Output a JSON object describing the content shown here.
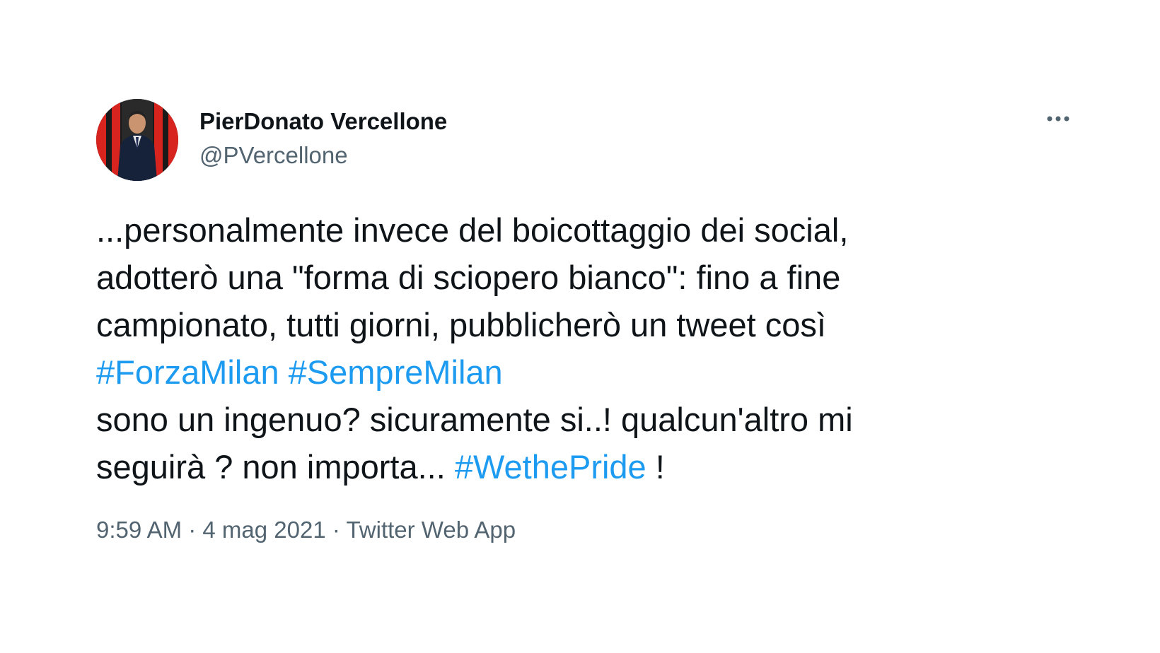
{
  "author": {
    "display_name": "PierDonato Vercellone",
    "handle": "@PVercellone",
    "avatar_icon": "profile-photo"
  },
  "menu": {
    "icon": "more-options-icon"
  },
  "tweet": {
    "line1": "...personalmente invece del boicottaggio dei social,",
    "line2": "adotterò una \"forma di sciopero bianco\": fino a fine",
    "line3": "campionato, tutti giorni, pubblicherò un tweet così",
    "hashtag1": "#ForzaMilan",
    "hashtag2": "#SempreMilan",
    "line5": "sono un ingenuo? sicuramente si..! qualcun'altro mi",
    "line6_start": "seguirà ? non importa... ",
    "hashtag3": "#WethePride",
    "line6_end": " !"
  },
  "meta": {
    "time": "9:59 AM",
    "separator": " · ",
    "date": "4 mag 2021",
    "source": "Twitter Web App"
  },
  "colors": {
    "text": "#0f1419",
    "secondary": "#536471",
    "link": "#1d9bf0"
  }
}
